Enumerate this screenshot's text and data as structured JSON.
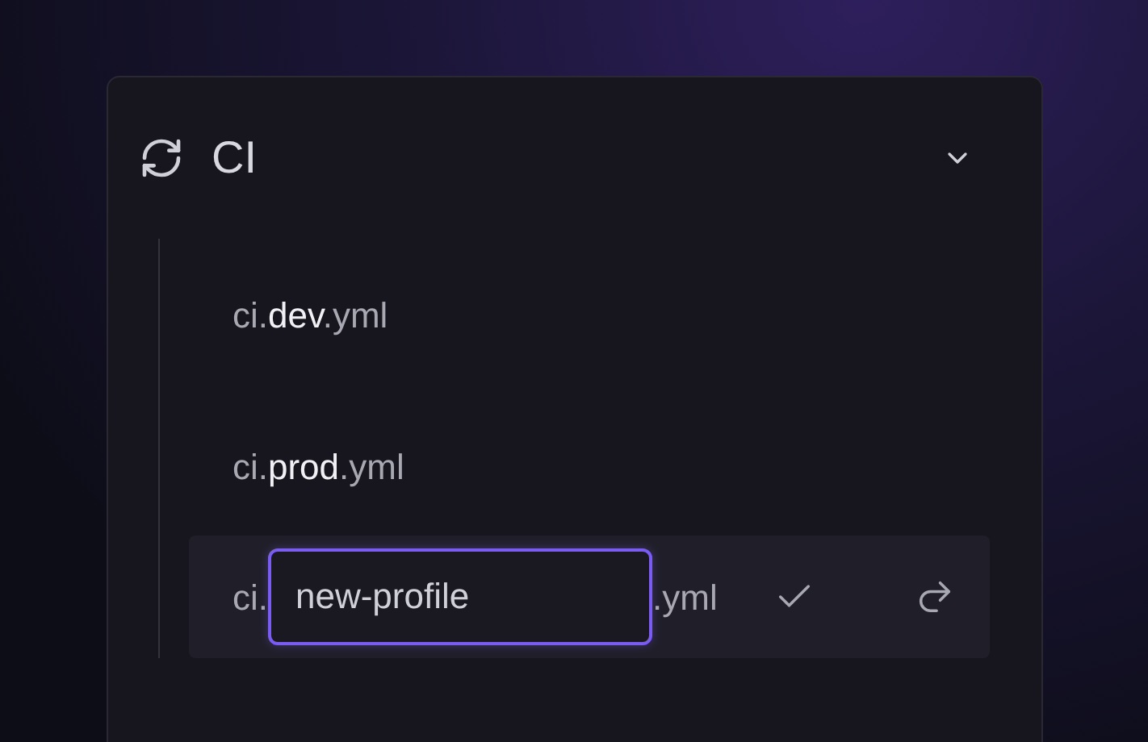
{
  "group": {
    "title": "CI",
    "expanded": true
  },
  "files": [
    {
      "label": "ci.**dev**.yml"
    },
    {
      "label": "ci.**prod**.yml"
    }
  ],
  "edit_row": {
    "prefix": "ci.",
    "value": "new-profile",
    "suffix": ".yml"
  }
}
